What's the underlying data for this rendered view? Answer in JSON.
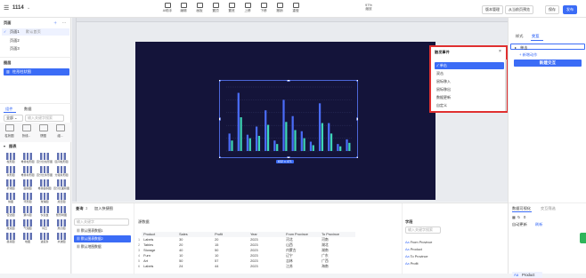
{
  "app": {
    "title": "1114",
    "undo_label": "撤销",
    "redo_label": "重做"
  },
  "toolbar": {
    "center_buttons": [
      "AI助手",
      "编辑",
      "画板",
      "置顶",
      "置底",
      "上移",
      "下移",
      "撤销",
      "重做"
    ],
    "zoom": {
      "value": "97%",
      "label": "缩放"
    },
    "version_label": "版本管理",
    "preview_label": "从当前页预览",
    "save_label": "保存",
    "publish_label": "发布"
  },
  "left_panel": {
    "pages_title": "页面",
    "pages_count": "3",
    "pages": [
      {
        "label": "页面1",
        "tag": "默认首页",
        "selected": true
      },
      {
        "label": "页面2",
        "tag": "",
        "selected": false
      },
      {
        "label": "页面3",
        "tag": "",
        "selected": false
      }
    ],
    "layers_title": "图层",
    "layer_item": "柱形柱状图",
    "tabs": [
      "组件",
      "数据"
    ],
    "filter_select": "全部",
    "search_placeholder": "输入关键字搜索",
    "recent_items": [
      "柱状图",
      "折线...",
      "饼图",
      "组..."
    ],
    "category": "图表",
    "chart_grid": [
      [
        "柱形图",
        "堆叠柱形图",
        "百分比柱形图",
        "区间柱形图"
      ],
      [
        "条形图",
        "堆叠条形图",
        "百分比条形图",
        "分组条形图"
      ],
      [
        "折线图",
        "面积图",
        "堆叠面积图",
        "百分比面积图"
      ],
      [
        "饼图",
        "环形图",
        "玫瑰图",
        "旭日图"
      ],
      [
        "雷达图",
        "漏斗图",
        "仪表盘",
        "矩形树图"
      ],
      [
        "散点图",
        "气泡图",
        "词云",
        "热力图"
      ],
      [
        "桑基图",
        "地图",
        "进度条",
        "水波图"
      ]
    ]
  },
  "canvas": {
    "size_label": "632 x 471"
  },
  "popup": {
    "title": "触发事件",
    "close_label": "×",
    "options": [
      {
        "label": "单击",
        "selected": true
      },
      {
        "label": "双击",
        "selected": false
      },
      {
        "label": "鼠标移入",
        "selected": false
      },
      {
        "label": "鼠标移出",
        "selected": false
      },
      {
        "label": "数据更新",
        "selected": false
      },
      {
        "label": "自定义",
        "selected": false
      }
    ]
  },
  "right_panel": {
    "tabs": [
      "样式",
      "交互"
    ],
    "active_tab": "交互",
    "event_select": "单击",
    "add_action": "+ 新增动作",
    "new_interaction": "新建交互",
    "data_tabs": [
      "数据可视化",
      "交互筛选"
    ],
    "sub_label": "自动更新",
    "sub_label_2": "刷新",
    "fields": [
      "Product",
      "Sales",
      "Profit"
    ],
    "selected_field": "Product"
  },
  "bottom_panel": {
    "query_label": "查询",
    "query_count": "3",
    "table_tab": "加入快捷图",
    "search_placeholder": "输入关键字",
    "datasets": [
      "默认图表数据1",
      "默认图表数据2",
      "默认地图数据"
    ],
    "selected_dataset": 1,
    "toolbar_label": "源数据",
    "columns": [
      "Product",
      "Sales",
      "Profit",
      "Year",
      "From Province",
      "To Province"
    ],
    "rows": [
      [
        "Labels",
        "30",
        "20",
        "2023",
        "河北",
        "河南"
      ],
      [
        "Tables",
        "20",
        "15",
        "2023",
        "山西",
        "湖北"
      ],
      [
        "Storage",
        "40",
        "50",
        "2023",
        "内蒙古",
        "湖南"
      ],
      [
        "Furn",
        "10",
        "10",
        "2023",
        "辽宁",
        "广东"
      ],
      [
        "Art",
        "50",
        "57",
        "2023",
        "吉林",
        "广西"
      ],
      [
        "Labels",
        "24",
        "44",
        "2023",
        "江苏",
        "海南"
      ]
    ],
    "fields_title": "字段",
    "fields_search": "输入关键字搜索",
    "field_items": [
      "From Province",
      "Product",
      "To Province",
      "Profit"
    ]
  },
  "chart_data": {
    "type": "bar",
    "title": "",
    "legend": [],
    "categories": [
      "A",
      "B",
      "C",
      "D",
      "E",
      "F",
      "G",
      "H",
      "I",
      "J",
      "K",
      "L",
      "M",
      "N"
    ],
    "series": [
      {
        "values": [
          30,
          100,
          28,
          42,
          70,
          18,
          88,
          60,
          34,
          16,
          82,
          48,
          12,
          20
        ]
      },
      {
        "values": [
          18,
          58,
          22,
          26,
          45,
          12,
          50,
          36,
          22,
          10,
          48,
          30,
          8,
          14
        ]
      }
    ],
    "ylim": [
      0,
      110
    ],
    "colors": [
      "#4a6cf7",
      "#3ed6b8"
    ],
    "grid": true
  }
}
